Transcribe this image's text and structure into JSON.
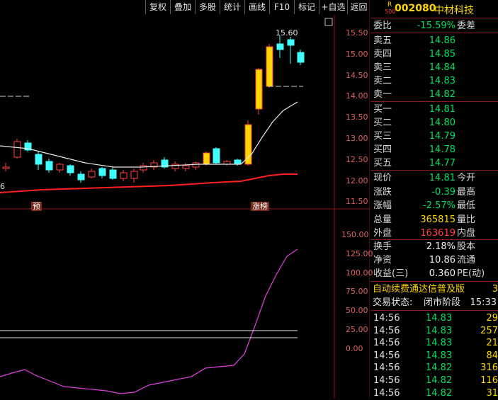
{
  "toolbar": {
    "buttons": [
      "复权",
      "叠加",
      "多股",
      "统计",
      "画线",
      "F10",
      "标记",
      "+自选",
      "返回"
    ]
  },
  "stock": {
    "logo_letter": "R",
    "logo_num": "500",
    "code": "002080",
    "name": "中材科技"
  },
  "chart": {
    "price_axis": [
      "15.50",
      "15.00",
      "14.50",
      "14.00",
      "13.50",
      "13.00",
      "12.50",
      "12.00",
      "11.50"
    ],
    "peak_label": "15.60",
    "left_edge_label": "6",
    "badges": [
      "预",
      "涨榜"
    ],
    "lower_axis": [
      "150.00",
      "125.00",
      "100.00",
      "75.00",
      "50.00",
      "25.00",
      "0.00"
    ]
  },
  "quote": {
    "weibi_label": "委比",
    "weibi_value": "-15.59%",
    "weicha_label": "委差",
    "sells": [
      {
        "label": "卖五",
        "price": "14.86"
      },
      {
        "label": "卖四",
        "price": "14.85"
      },
      {
        "label": "卖三",
        "price": "14.84"
      },
      {
        "label": "卖二",
        "price": "14.83"
      },
      {
        "label": "卖一",
        "price": "14.82"
      }
    ],
    "buys": [
      {
        "label": "买一",
        "price": "14.81"
      },
      {
        "label": "买二",
        "price": "14.80"
      },
      {
        "label": "买三",
        "price": "14.79"
      },
      {
        "label": "买四",
        "price": "14.78"
      },
      {
        "label": "买五",
        "price": "14.77"
      }
    ],
    "stats": [
      {
        "k": "现价",
        "v": "14.81",
        "k2": "今开"
      },
      {
        "k": "涨跌",
        "v": "-0.39",
        "k2": "最高"
      },
      {
        "k": "涨幅",
        "v": "-2.57%",
        "k2": "最低"
      },
      {
        "k": "总量",
        "v": "365815",
        "k2": "量比"
      },
      {
        "k": "外盘",
        "v": "163619",
        "k2": "内盘"
      }
    ],
    "fund": [
      {
        "k": "换手",
        "v": "2.18%",
        "k2": "股本"
      },
      {
        "k": "净资",
        "v": "10.86",
        "k2": "流通"
      },
      {
        "k": "收益(三)",
        "v": "0.360",
        "k2": "PE(动)"
      }
    ],
    "banner": "自动续费通达信普及版",
    "banner_tail": "3",
    "status_label": "交易状态:",
    "status_value": "闭市阶段",
    "status_time": "15:33",
    "ticks": [
      {
        "t": "14:56",
        "p": "14.83",
        "q": "29"
      },
      {
        "t": "14:56",
        "p": "14.83",
        "q": "257"
      },
      {
        "t": "14:56",
        "p": "14.83",
        "q": "21"
      },
      {
        "t": "14:56",
        "p": "14.83",
        "q": "84"
      },
      {
        "t": "14:56",
        "p": "14.82",
        "q": "316"
      },
      {
        "t": "14:56",
        "p": "14.82",
        "q": "116"
      },
      {
        "t": "14:56",
        "p": "14.82",
        "q": "31"
      }
    ]
  },
  "colors": {
    "up": "#ff4040",
    "down": "#00e060",
    "yellow": "#ffd700",
    "frame": "#8a1a1a",
    "cyan": "#40ffff",
    "magenta": "#e040e0"
  }
}
